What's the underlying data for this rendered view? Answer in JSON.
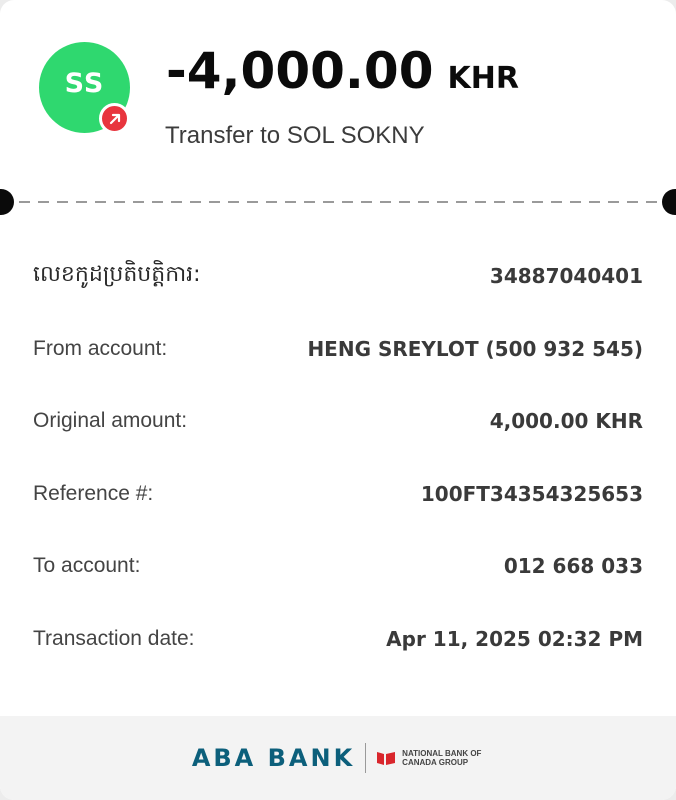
{
  "header": {
    "avatar_initials": "SS",
    "badge_icon": "outgoing-arrow-icon",
    "amount": "-4,000.00",
    "currency": "KHR",
    "subtitle": "Transfer to SOL SOKNY"
  },
  "details": [
    {
      "label": "លេខកូដប្រតិបត្តិការ:",
      "value": "34887040401"
    },
    {
      "label": "From account:",
      "value": "HENG SREYLOT (500 932 545)"
    },
    {
      "label": "Original amount:",
      "value": "4,000.00 KHR"
    },
    {
      "label": "Reference #:",
      "value": "100FT34354325653"
    },
    {
      "label": "To account:",
      "value": "012 668 033"
    },
    {
      "label": "Transaction date:",
      "value": "Apr 11, 2025 02:32 PM"
    }
  ],
  "footer": {
    "bank_name": "ABA BANK",
    "partner_logo_text": "NATIONAL BANK OF CANADA GROUP"
  },
  "colors": {
    "avatar_bg": "#2fd86f",
    "badge_bg": "#e8353e",
    "brand_teal": "#0c5f7b",
    "brand_red": "#d9262c"
  }
}
